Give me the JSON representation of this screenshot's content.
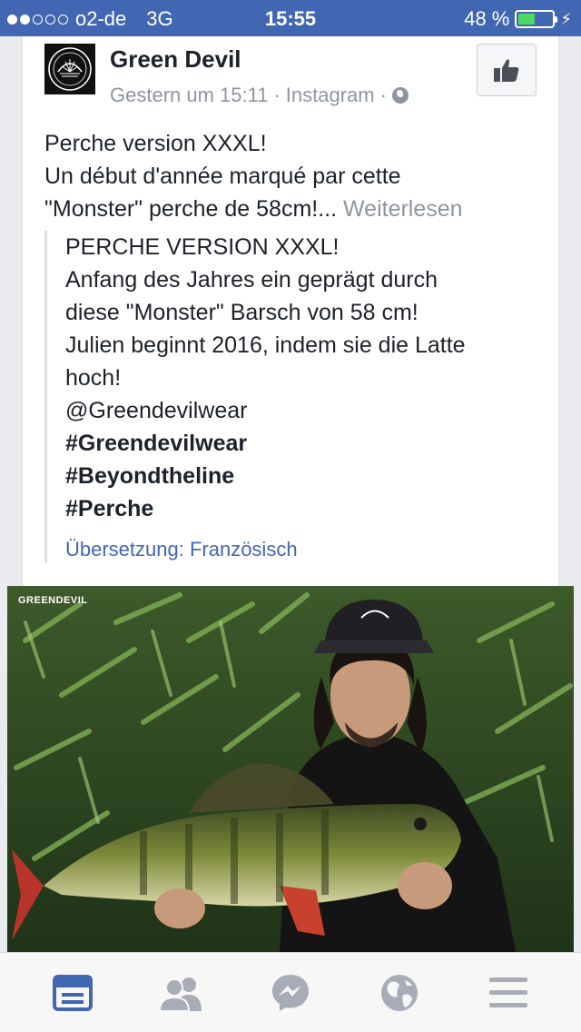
{
  "status_bar": {
    "carrier": "o2-de",
    "network": "3G",
    "time": "15:55",
    "battery": "48 %",
    "battery_level": 0.48,
    "signal_bars": 2
  },
  "post": {
    "page_name": "Green Devil",
    "timestamp": "Gestern um 15:11",
    "separator": "·",
    "source": "Instagram",
    "privacy_icon": "globe-icon",
    "like_icon": "thumbs-up-icon",
    "text_lines": [
      "Perche version XXXL!",
      "Un début d'année marqué par cette",
      "\"Monster\" perche de 58cm!..."
    ],
    "read_more": "Weiterlesen",
    "translation": {
      "lines": [
        "PERCHE VERSION XXXL!",
        "Anfang des Jahres ein geprägt durch",
        "diese \"Monster\" Barsch von 58 cm!",
        "Julien beginnt 2016, indem sie die Latte",
        "hoch!",
        "@Greendevilwear"
      ],
      "hashtags": [
        "#Greendevilwear",
        "#Beyondtheline",
        "#Perche"
      ],
      "link": "Übersetzung: Französisch"
    },
    "photo_watermark": "GREENDEVIL"
  },
  "tab_bar": {
    "items": [
      {
        "name": "news-feed",
        "icon": "news-feed-icon",
        "active": true
      },
      {
        "name": "friends",
        "icon": "friends-icon",
        "active": false
      },
      {
        "name": "messenger",
        "icon": "messenger-icon",
        "active": false
      },
      {
        "name": "notifications",
        "icon": "globe-icon",
        "active": false
      },
      {
        "name": "more",
        "icon": "menu-icon",
        "active": false
      }
    ]
  },
  "colors": {
    "brand": "#4267b2",
    "text": "#1d2129",
    "muted": "#90949c",
    "tab_inactive": "#a7acb6"
  }
}
